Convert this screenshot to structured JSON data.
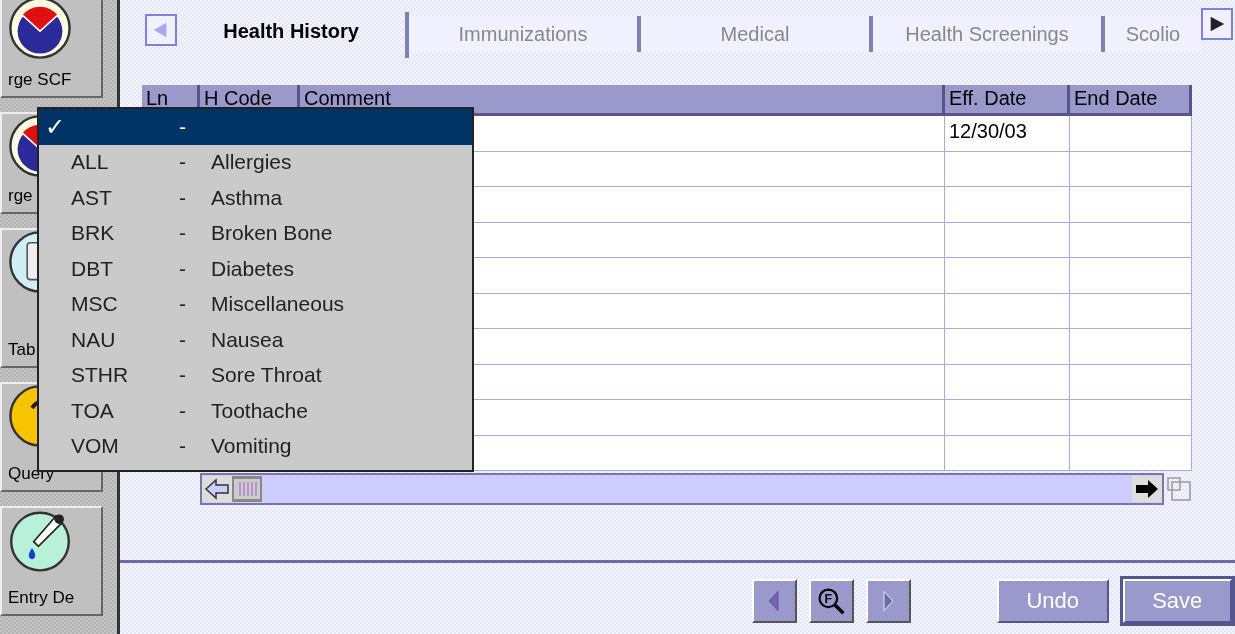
{
  "sidebar": {
    "items": [
      {
        "label": "rge SCF"
      },
      {
        "label": "rge"
      },
      {
        "label": "Tab"
      },
      {
        "label": "Query"
      },
      {
        "label": "Entry De"
      }
    ]
  },
  "tabs": [
    {
      "label": "Health History",
      "selected": true
    },
    {
      "label": "Immunizations",
      "selected": false
    },
    {
      "label": "Medical",
      "selected": false
    },
    {
      "label": "Health Screenings",
      "selected": false
    },
    {
      "label": "Scolio",
      "selected": false
    }
  ],
  "table": {
    "columns": [
      "Ln",
      "H Code",
      "Comment",
      "Eff. Date",
      "End Date"
    ],
    "rows": [
      {
        "eff_date": "12/30/03"
      }
    ]
  },
  "dropdown": {
    "check": "✓",
    "items": [
      {
        "separator": "-",
        "selected": true
      },
      {
        "code": "ALL",
        "separator": "-",
        "label": "Allergies",
        "selected": false
      },
      {
        "code": "AST",
        "separator": "-",
        "label": "Asthma",
        "selected": false
      },
      {
        "code": "BRK",
        "separator": "-",
        "label": "Broken Bone",
        "selected": false
      },
      {
        "code": "DBT",
        "separator": "-",
        "label": "Diabetes",
        "selected": false
      },
      {
        "code": "MSC",
        "separator": "-",
        "label": "Miscellaneous",
        "selected": false
      },
      {
        "code": "NAU",
        "separator": "-",
        "label": "Nausea",
        "selected": false
      },
      {
        "code": "STHR",
        "separator": "-",
        "label": "Sore Throat",
        "selected": false
      },
      {
        "code": "TOA",
        "separator": "-",
        "label": "Toothache",
        "selected": false
      },
      {
        "code": "VOM",
        "separator": "-",
        "label": "Vomiting",
        "selected": false
      }
    ]
  },
  "find_button": {
    "glyph": "F"
  },
  "buttons": [
    "Undo",
    "Save"
  ]
}
